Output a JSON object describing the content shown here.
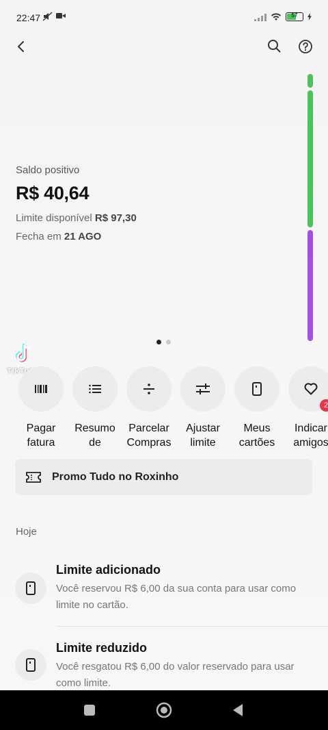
{
  "status_bar": {
    "time": "22:47",
    "battery_level": "57"
  },
  "balance": {
    "label": "Saldo positivo",
    "amount": "R$ 40,64",
    "limit_label": "Limite disponível",
    "limit_value": "R$ 97,30",
    "close_label": "Fecha em",
    "close_value": "21 AGO"
  },
  "progress": {
    "used_fraction": 0.01,
    "available_fraction": 0.52,
    "reserved_fraction": 0.42,
    "colors": {
      "used": "#4bc35a",
      "available": "#4bc35a",
      "reserved": "#a64fe0"
    }
  },
  "carousel": {
    "pages": 2,
    "active": 0
  },
  "watermark": {
    "text": "TikTok"
  },
  "actions": [
    {
      "label_1": "Pagar",
      "label_2": "fatura",
      "icon": "barcode-icon"
    },
    {
      "label_1": "Resumo",
      "label_2": "de",
      "icon": "list-icon"
    },
    {
      "label_1": "Parcelar",
      "label_2": "Compras",
      "icon": "divide-icon"
    },
    {
      "label_1": "Ajustar",
      "label_2": "limite",
      "icon": "sliders-icon"
    },
    {
      "label_1": "Meus",
      "label_2": "cartões",
      "icon": "card-icon"
    },
    {
      "label_1": "Indicar",
      "label_2": "amigos",
      "icon": "heart-icon",
      "badge": "2"
    }
  ],
  "promo": {
    "text": "Promo Tudo no Roxinho",
    "icon": "ticket-icon"
  },
  "feed": {
    "section": "Hoje",
    "items": [
      {
        "title": "Limite adicionado",
        "description": "Você reservou R$ 6,00 da sua conta para usar como limite no cartão.",
        "icon": "card-icon"
      },
      {
        "title": "Limite reduzido",
        "description": "Você resgatou R$ 6,00 do valor reservado para usar como limite.",
        "icon": "card-icon"
      }
    ]
  },
  "accent_color": "#820ad1"
}
